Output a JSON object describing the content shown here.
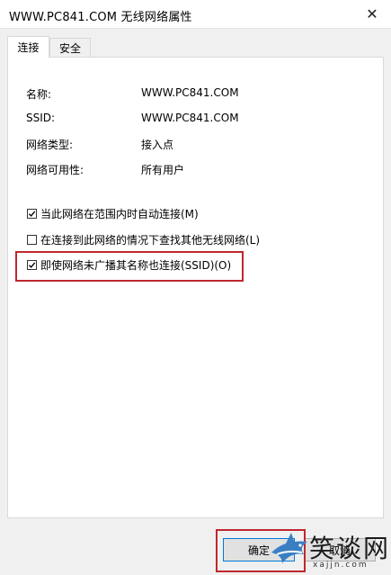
{
  "window": {
    "title": "WWW.PC841.COM 无线网络属性",
    "close_glyph": "✕"
  },
  "tabs": [
    {
      "label": "连接",
      "active": true
    },
    {
      "label": "安全",
      "active": false
    }
  ],
  "info": [
    {
      "label": "名称:",
      "value": "WWW.PC841.COM"
    },
    {
      "label": "SSID:",
      "value": "WWW.PC841.COM"
    },
    {
      "label": "网络类型:",
      "value": "接入点"
    },
    {
      "label": "网络可用性:",
      "value": "所有用户"
    }
  ],
  "options": [
    {
      "label": "当此网络在范围内时自动连接(M)",
      "checked": true
    },
    {
      "label": "在连接到此网络的情况下查找其他无线网络(L)",
      "checked": false
    },
    {
      "label": "即使网络未广播其名称也连接(SSID)(O)",
      "checked": true,
      "highlighted": true
    }
  ],
  "buttons": {
    "ok": "确定",
    "cancel": "取消"
  },
  "watermark": {
    "text": "笑谈网",
    "url": "xajjn.com"
  },
  "colors": {
    "highlight": "#c0272d",
    "accent": "#0078d7"
  }
}
